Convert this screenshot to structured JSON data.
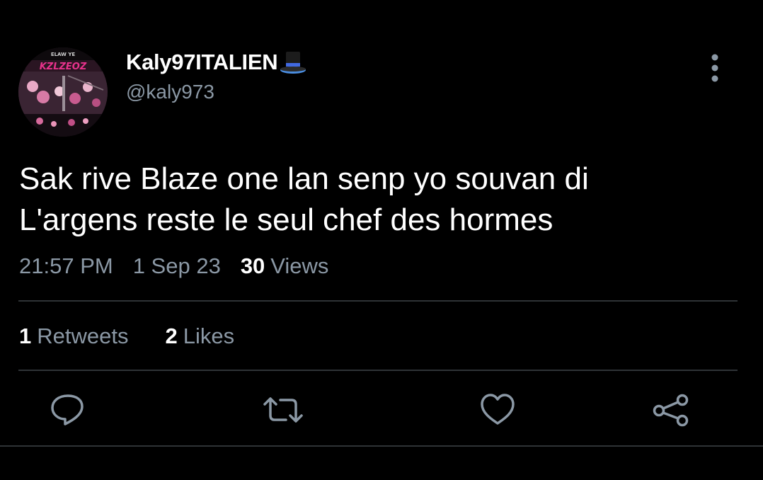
{
  "user": {
    "display_name": "Kaly97ITALIEN",
    "handle": "@kaly973",
    "name_emoji_icon": "top-hat-icon"
  },
  "tweet": {
    "text_lines": [
      "Sak rive Blaze one lan senp yo souvan di",
      "L'argens reste le seul chef des hormes"
    ],
    "time": "21:57 PM",
    "date": "1 Sep 23",
    "views_count": "30",
    "views_label": "Views"
  },
  "stats": {
    "retweets_count": "1",
    "retweets_label": "Retweets",
    "likes_count": "2",
    "likes_label": "Likes"
  },
  "actions": [
    {
      "name": "reply",
      "icon": "reply-icon"
    },
    {
      "name": "retweet",
      "icon": "retweet-icon"
    },
    {
      "name": "like",
      "icon": "heart-icon"
    },
    {
      "name": "share",
      "icon": "share-icon"
    }
  ],
  "colors": {
    "background": "#000000",
    "primary_text": "#ffffff",
    "secondary_text": "#8b98a5",
    "divider": "#2f3336",
    "avatar_accent": "#e8328c"
  }
}
